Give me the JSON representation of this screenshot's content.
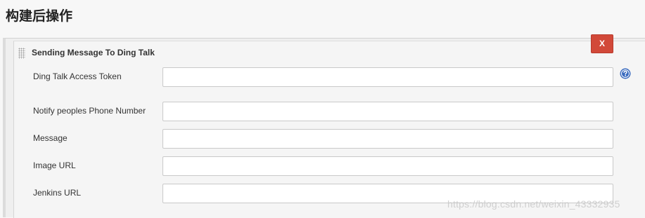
{
  "section": {
    "title": "构建后操作"
  },
  "block": {
    "title": "Sending Message To Ding Talk",
    "delete_label": "X"
  },
  "fields": [
    {
      "label": "Ding Talk Access Token",
      "value": "",
      "has_help": true
    },
    {
      "label": "Notify peoples Phone Number",
      "value": ""
    },
    {
      "label": "Message",
      "value": ""
    },
    {
      "label": "Image URL",
      "value": ""
    },
    {
      "label": "Jenkins URL",
      "value": ""
    }
  ],
  "watermark": "https://blog.csdn.net/weixin_43332935",
  "colors": {
    "delete_button": "#d24939",
    "help_icon": "#3a6bbf",
    "background": "#f7f7f7"
  },
  "icons": {
    "help": "question-circle-icon",
    "drag": "drag-handle-icon"
  }
}
